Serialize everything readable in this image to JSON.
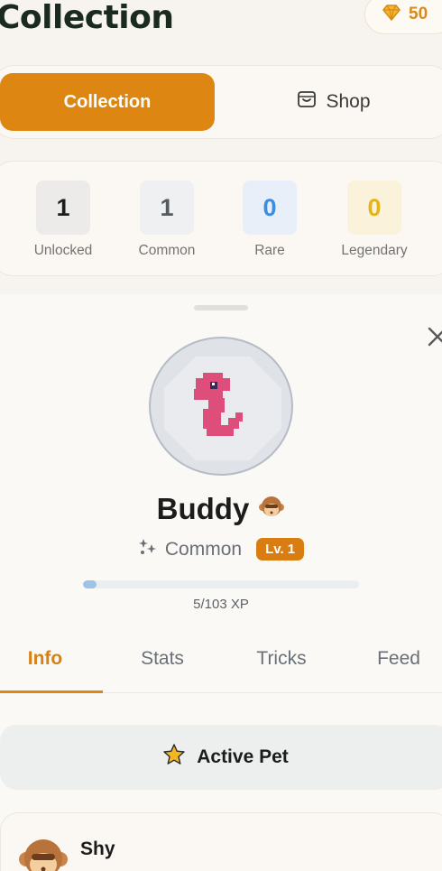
{
  "header": {
    "title": "Collection",
    "gems": "50"
  },
  "tabs": [
    {
      "label": "Collection",
      "active": true
    },
    {
      "label": "Shop",
      "active": false
    }
  ],
  "stats": [
    {
      "value": "1",
      "label": "Unlocked",
      "color": "#1e1e1e",
      "bg": "#ecebe9"
    },
    {
      "value": "1",
      "label": "Common",
      "color": "#555a60",
      "bg": "#eef0f1"
    },
    {
      "value": "0",
      "label": "Rare",
      "color": "#3a8de0",
      "bg": "#e8eff8"
    },
    {
      "value": "0",
      "label": "Legendary",
      "color": "#e6b415",
      "bg": "#fbf2db"
    }
  ],
  "pet": {
    "name": "Buddy",
    "rarity": "Common",
    "level": "Lv. 1",
    "xp_text": "5/103 XP",
    "xp_current": 5,
    "xp_max": 103
  },
  "detail_tabs": [
    {
      "label": "Info",
      "active": true
    },
    {
      "label": "Stats",
      "active": false
    },
    {
      "label": "Tricks",
      "active": false
    },
    {
      "label": "Feed",
      "active": false
    }
  ],
  "active_pet_label": "Active Pet",
  "trait": {
    "name": "Shy"
  },
  "colors": {
    "accent": "#de8612",
    "background": "#f7f3ee"
  },
  "icons": {
    "gem": "gem-icon",
    "shop": "shop-bag-icon",
    "close": "close-icon",
    "rarity": "sparkle-icon",
    "mood": "monkey-face-icon",
    "star": "star-icon"
  }
}
